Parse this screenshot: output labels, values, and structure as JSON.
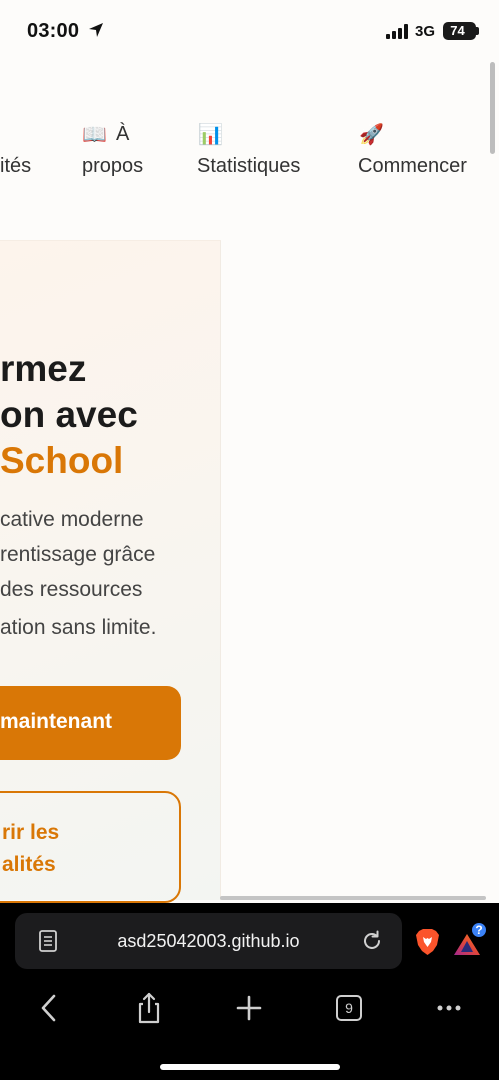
{
  "status_bar": {
    "time": "03:00",
    "network": "3G",
    "battery": "74",
    "battery_level_percent": 74
  },
  "nav": {
    "items": [
      {
        "emoji": "",
        "line1": "",
        "line2": "ités"
      },
      {
        "emoji": "📖",
        "line1": "À",
        "line2": "propos"
      },
      {
        "emoji": "📊",
        "line1": "",
        "line2": "Statistiques"
      },
      {
        "emoji": "🚀",
        "line1": "",
        "line2": "Commencer"
      }
    ]
  },
  "hero": {
    "title_line1": "rmez",
    "title_line2": "on avec",
    "title_accent": "School",
    "desc_lines": [
      "cative moderne",
      "rentissage grâce",
      " des ressources",
      "ation sans limite."
    ],
    "primary_cta": "maintenant",
    "secondary_cta_line1": "rir les",
    "secondary_cta_line2": "alités"
  },
  "browser": {
    "url": "asd25042003.github.io",
    "tab_count": "9",
    "rewards_badge": "?"
  },
  "colors": {
    "accent": "#d97706",
    "background": "#fdfcfa",
    "chrome": "#000000",
    "url_box": "#1c1c1e"
  },
  "icons": {
    "location": "location-arrow-icon",
    "signal": "cellular-signal-icon",
    "reader": "reader-mode-icon",
    "reload": "reload-icon",
    "brave": "brave-lion-icon",
    "rewards": "brave-rewards-icon",
    "back": "chevron-left-icon",
    "share": "share-icon",
    "new_tab": "plus-icon",
    "tabs": "tabs-icon",
    "more": "more-icon"
  }
}
